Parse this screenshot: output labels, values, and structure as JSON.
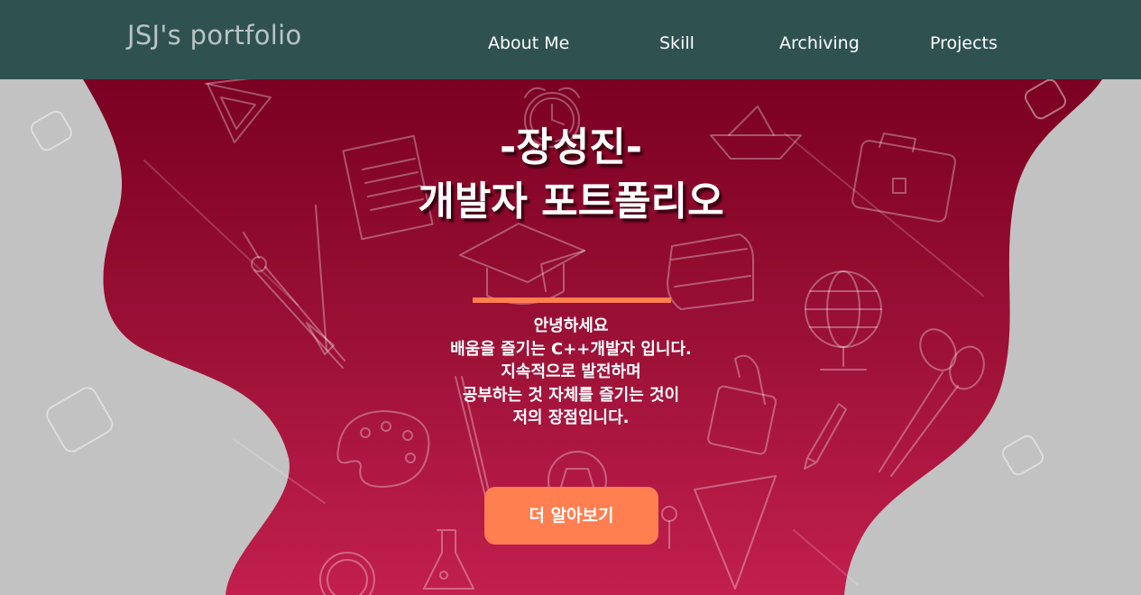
{
  "header": {
    "brand": "JSJ's portfolio",
    "nav": [
      {
        "label": "About Me"
      },
      {
        "label": "Skill"
      },
      {
        "label": "Archiving"
      },
      {
        "label": "Projects"
      }
    ]
  },
  "hero": {
    "title_line1": "-장성진-",
    "title_line2": "개발자 포트폴리오",
    "intro_lines": [
      "안녕하세요",
      "배움을 즐기는 C++개발자 입니다.",
      "지속적으로 발전하며",
      "공부하는 것 자체를 즐기는 것이",
      "저의 장점입니다."
    ],
    "cta_label": "더 알아보기"
  },
  "colors": {
    "header_bg": "#2f5251",
    "brand_text": "#b9c3c3",
    "hero_crimson_top": "#7a0020",
    "hero_crimson_bottom": "#c41e4e",
    "side_gray": "#c2c2c2",
    "accent": "#ff7f50"
  },
  "background_icons": [
    "protractor-icon",
    "ruler-icon",
    "alarm-clock-icon",
    "notepad-icon",
    "paper-boat-icon",
    "briefcase-icon",
    "compass-icon",
    "graduation-cap-icon",
    "book-icon",
    "globe-icon",
    "scissors-icon",
    "paint-palette-icon",
    "paperclip-icon",
    "pencil-icon",
    "soccer-ball-icon",
    "flask-icon",
    "calculator-icon",
    "pushpin-icon",
    "magnifier-icon",
    "paintbrush-icon"
  ]
}
